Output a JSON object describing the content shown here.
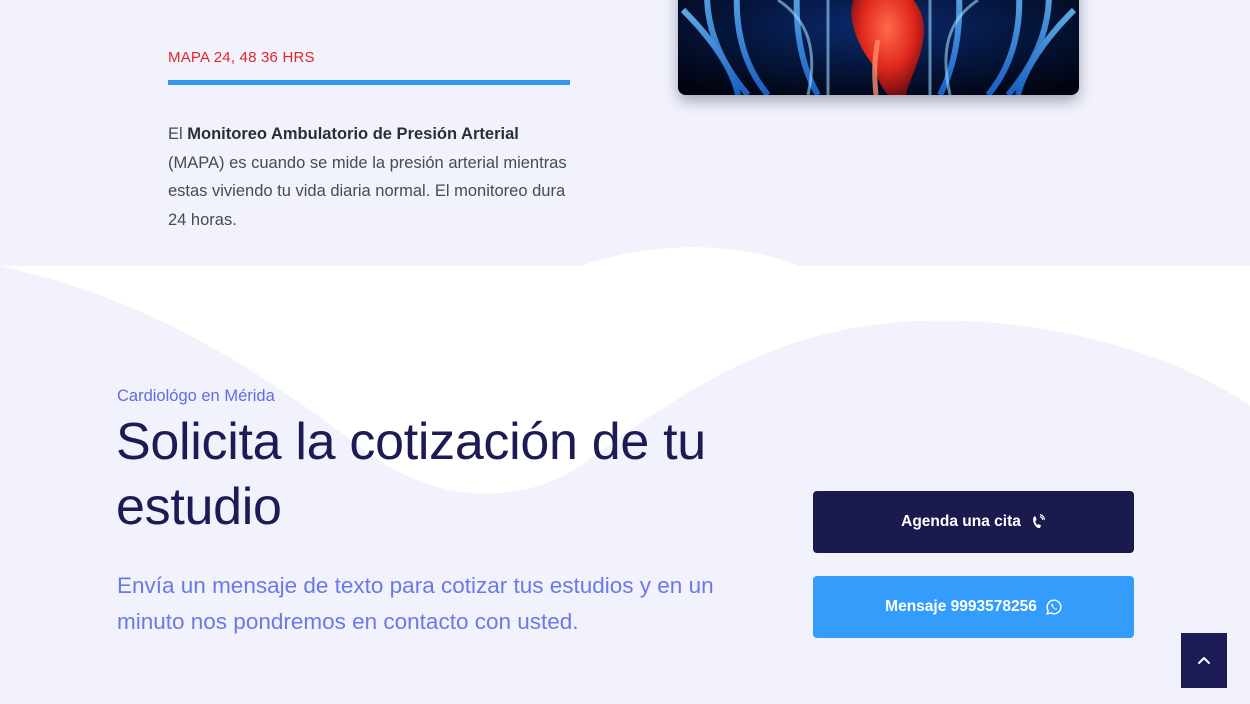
{
  "service": {
    "label": "MAPA 24, 48 36 HRS",
    "desc_prefix": "El ",
    "desc_bold": "Monitoreo Ambulatorio de Presión Arterial",
    "desc_suffix": " (MAPA) es cuando se mide la presión arterial mientras estas viviendo tu vida diaria normal. El monitoreo dura 24 horas.",
    "image_icon": "heart-xray-image"
  },
  "cta": {
    "eyebrow": "Cardiológo en Mérida",
    "title": "Solicita la cotización de tu estudio",
    "description": "Envía un mensaje de texto para cotizar tus estudios y en un minuto nos pondremos en contacto con usted."
  },
  "buttons": {
    "appointment_label": "Agenda una cita",
    "appointment_icon": "phone-icon",
    "whatsapp_label": "Mensaje 9993578256",
    "whatsapp_icon": "whatsapp-icon"
  },
  "scroll_top": {
    "icon": "chevron-up-icon"
  },
  "colors": {
    "accent_red": "#e4262b",
    "accent_blue": "#3199f2",
    "navy": "#1a1a4e",
    "lavender_text": "#6b79e6",
    "background": "#f1f2fc"
  }
}
